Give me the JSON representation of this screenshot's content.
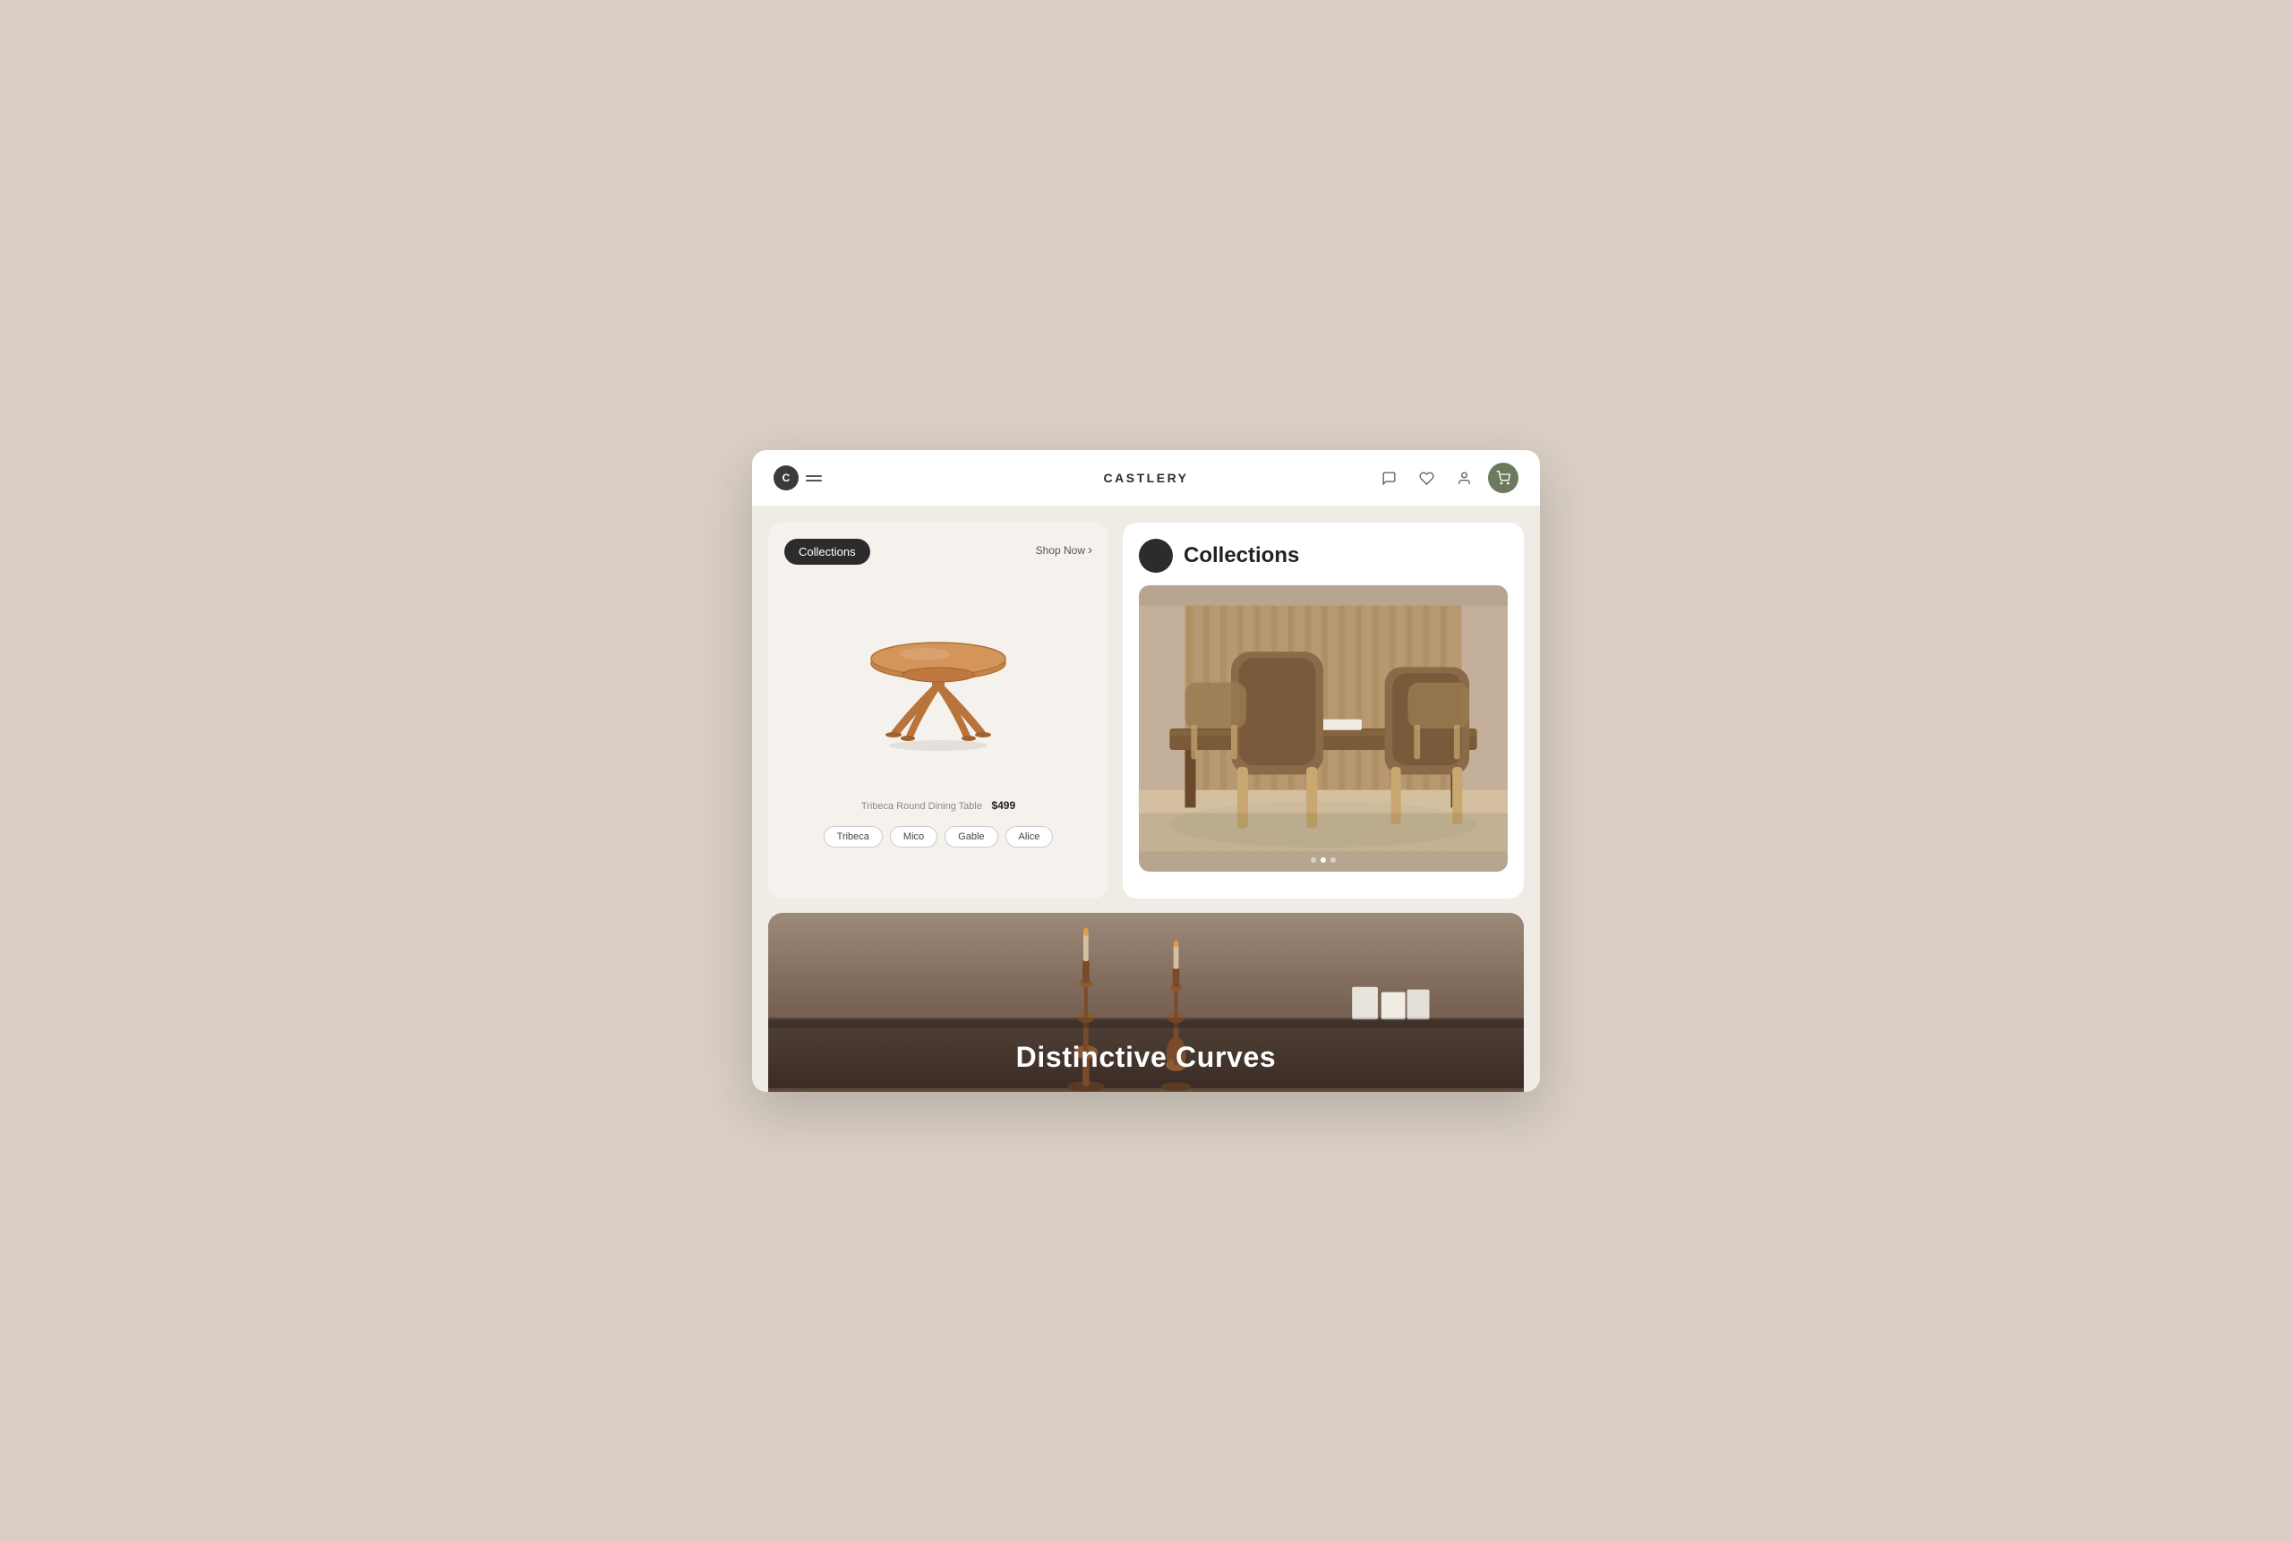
{
  "nav": {
    "brand": "CASTLERY",
    "logo_letter": "C",
    "menu_label": "menu",
    "icons": {
      "chat": "💬",
      "wishlist": "♡",
      "account": "👤",
      "cart": "🛒"
    }
  },
  "left_card": {
    "badge_label": "Collections",
    "shop_now_label": "Shop Now",
    "product_name": "Tribeca Round Dining Table",
    "product_price": "$499",
    "tags": [
      "Tribeca",
      "Mico",
      "Gable",
      "Alice"
    ]
  },
  "right_card": {
    "title": "Collections",
    "indicator_dots": [
      false,
      true,
      false
    ]
  },
  "bottom_banner": {
    "heading": "Distinctive Curves"
  }
}
